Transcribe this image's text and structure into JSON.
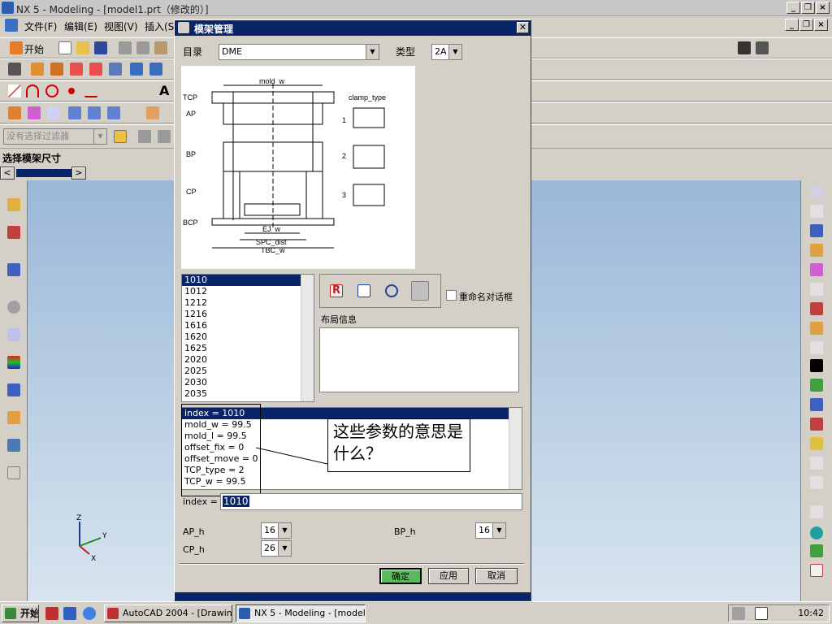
{
  "window": {
    "title": "NX 5 - Modeling - [model1.prt（修改的）]"
  },
  "menu": [
    "文件(F)",
    "编辑(E)",
    "视图(V)",
    "插入(S)"
  ],
  "toolbar": {
    "start_label": "开始",
    "filter_placeholder": "没有选择过滤器"
  },
  "status": {
    "prompt": "选择模架尺寸"
  },
  "dialog": {
    "title": "模架管理",
    "catalog_label": "目录",
    "catalog_value": "DME",
    "type_label": "类型",
    "type_value": "2A",
    "diagram": {
      "labels": [
        "TCP",
        "AP",
        "BP",
        "CP",
        "BCP",
        "mold_w",
        "clamp_type",
        "1",
        "2",
        "3",
        "EJ_w",
        "SPC_dist",
        "TBC_w"
      ]
    },
    "sizes": [
      "1010",
      "1012",
      "1212",
      "1216",
      "1616",
      "1620",
      "1625",
      "2020",
      "2025",
      "2030",
      "2035"
    ],
    "rename_label": "重命名对话框",
    "layout_label": "布局信息",
    "params": [
      "index = 1010",
      "mold_w = 99.5",
      "mold_l = 99.5",
      "offset_fix = 0",
      "offset_move = 0",
      "TCP_type = 2",
      "TCP_w = 99.5"
    ],
    "annotation": "这些参数的意思是什么？",
    "index_label": "index =",
    "index_value": "1010",
    "ap_h_label": "AP_h",
    "ap_h_value": "16",
    "bp_h_label": "BP_h",
    "bp_h_value": "16",
    "cp_h_label": "CP_h",
    "cp_h_value": "26",
    "ok": "确定",
    "apply": "应用",
    "cancel": "取消"
  },
  "taskbar": {
    "start": "开始",
    "tasks": [
      "AutoCAD 2004 - [Drawin...",
      "NX 5 - Modeling - [model..."
    ],
    "clock": "10:42"
  },
  "axes": {
    "z": "Z",
    "y": "Y",
    "x": "X"
  }
}
